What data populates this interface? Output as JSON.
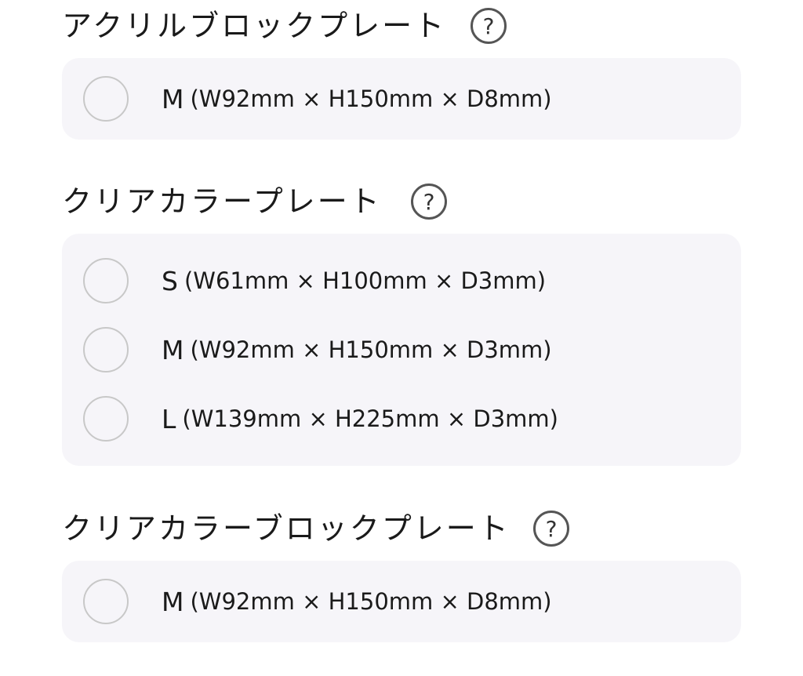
{
  "sections": [
    {
      "title": "アクリルブロックプレート",
      "help_icon": "question-mark-icon",
      "help_glyph": "?",
      "options": [
        {
          "size": "M",
          "dims": "(W92mm × H150mm × D8mm)"
        }
      ]
    },
    {
      "title": "クリアカラープレート",
      "help_icon": "question-mark-icon",
      "help_glyph": "?",
      "options": [
        {
          "size": "S",
          "dims": "(W61mm × H100mm × D3mm)"
        },
        {
          "size": "M",
          "dims": "(W92mm × H150mm × D3mm)"
        },
        {
          "size": "L",
          "dims": "(W139mm × H225mm × D3mm)"
        }
      ]
    },
    {
      "title": "クリアカラーブロックプレート",
      "help_icon": "question-mark-icon",
      "help_glyph": "?",
      "options": [
        {
          "size": "M",
          "dims": "(W92mm × H150mm × D8mm)"
        }
      ]
    }
  ],
  "colors": {
    "card_background": "#f6f5f9",
    "radio_border": "#c8c8c8",
    "text": "#1a1a1a",
    "help_icon_border": "#555555"
  }
}
